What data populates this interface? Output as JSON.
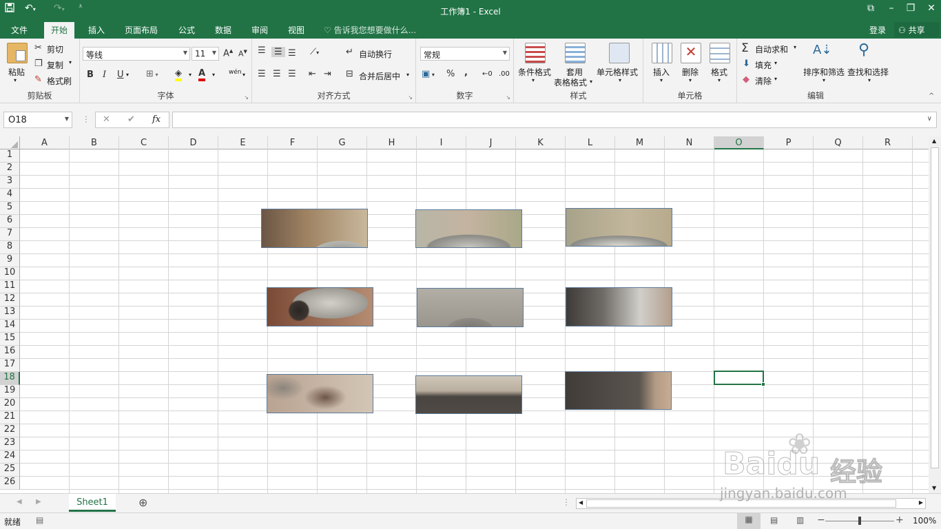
{
  "window": {
    "title": "工作簿1 - Excel"
  },
  "quick_access": {
    "save_icon": "save-icon",
    "undo_icon": "undo-icon",
    "redo_icon": "redo-icon"
  },
  "tabs": [
    {
      "label": "文件",
      "active": false
    },
    {
      "label": "开始",
      "active": true
    },
    {
      "label": "插入",
      "active": false
    },
    {
      "label": "页面布局",
      "active": false
    },
    {
      "label": "公式",
      "active": false
    },
    {
      "label": "数据",
      "active": false
    },
    {
      "label": "审阅",
      "active": false
    },
    {
      "label": "视图",
      "active": false
    }
  ],
  "tellme": "告诉我您想要做什么...",
  "account": {
    "login": "登录",
    "share": "共享"
  },
  "ribbon": {
    "clipboard": {
      "label": "剪贴板",
      "paste": "粘贴",
      "cut": "剪切",
      "copy": "复制",
      "format_painter": "格式刷"
    },
    "font": {
      "label": "字体",
      "name": "等线",
      "size": "11",
      "bold": "B",
      "italic": "I",
      "underline": "U",
      "phonetic": "wén"
    },
    "alignment": {
      "label": "对齐方式",
      "wrap": "自动换行",
      "merge": "合并后居中"
    },
    "number": {
      "label": "数字",
      "format": "常规",
      "percent": "%",
      "comma": ","
    },
    "styles": {
      "label": "样式",
      "conditional": "条件格式",
      "table_1": "套用",
      "table_2": "表格格式",
      "cell_styles": "单元格样式"
    },
    "cells": {
      "label": "单元格",
      "insert": "插入",
      "delete": "删除",
      "format": "格式"
    },
    "editing": {
      "label": "编辑",
      "autosum": "自动求和",
      "fill": "填充",
      "clear": "清除",
      "sort": "排序和筛选",
      "find": "查找和选择"
    }
  },
  "formula_bar": {
    "name_box": "O18",
    "fx": "fx",
    "formula": ""
  },
  "columns": [
    "A",
    "B",
    "C",
    "D",
    "E",
    "F",
    "G",
    "H",
    "I",
    "J",
    "K",
    "L",
    "M",
    "N",
    "O",
    "P",
    "Q",
    "R"
  ],
  "rows": [
    "1",
    "2",
    "3",
    "4",
    "5",
    "6",
    "7",
    "8",
    "9",
    "10",
    "11",
    "12",
    "13",
    "14",
    "15",
    "16",
    "17",
    "18",
    "19",
    "20",
    "21",
    "22",
    "23",
    "24",
    "25",
    "26"
  ],
  "selected": {
    "column": "O",
    "row": "18"
  },
  "sheets": [
    {
      "name": "Sheet1",
      "active": true
    }
  ],
  "status": {
    "ready": "就绪",
    "zoom": "100%"
  },
  "watermark": {
    "brand": "Baidu",
    "cn": "经验",
    "url": "jingyan.baidu.com"
  },
  "colors": {
    "accent": "#217346"
  }
}
